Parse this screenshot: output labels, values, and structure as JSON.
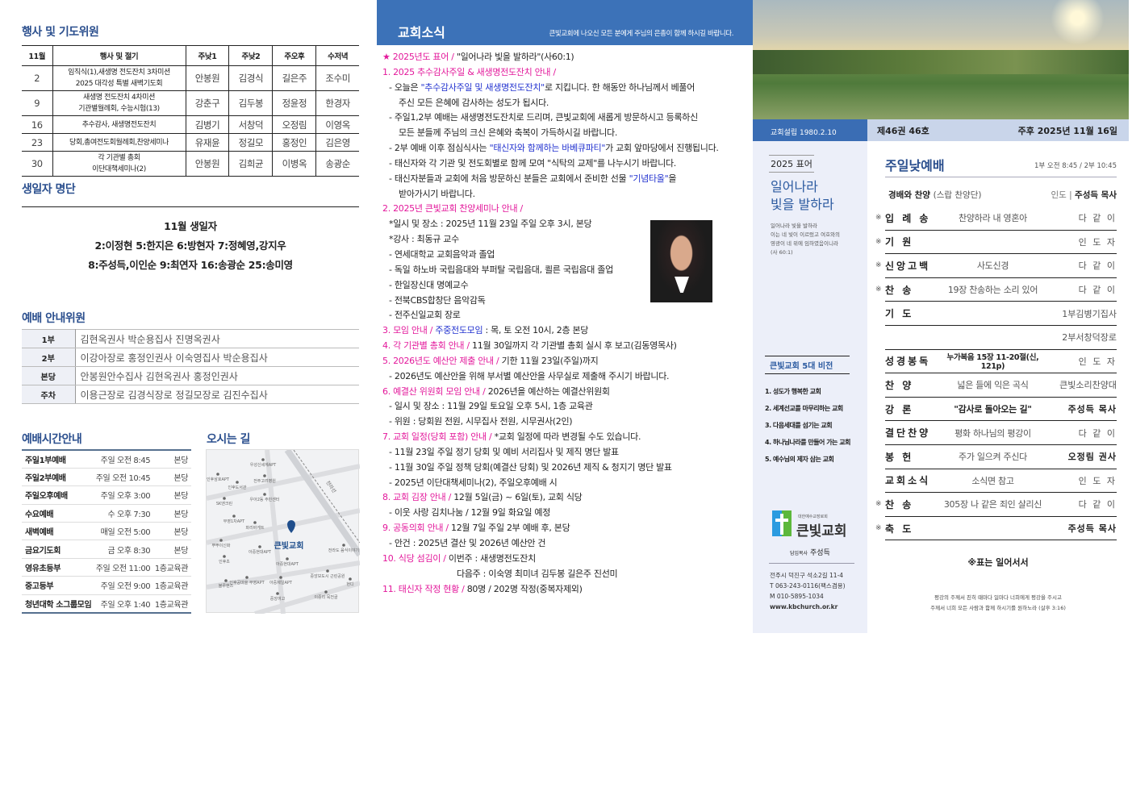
{
  "events": {
    "title": "행사 및 기도위원",
    "headers": [
      "11월",
      "행사 및 절기",
      "주낮1",
      "주낮2",
      "주오후",
      "수저녁"
    ],
    "rows": [
      {
        "d": "2",
        "e1": "임직식(1),새생명 전도잔치 3차미션",
        "e2": "2025 대각성 특별 새벽기도회",
        "a": "안봉원",
        "b": "김경식",
        "c": "길은주",
        "w": "조수미"
      },
      {
        "d": "9",
        "e1": "새생명 전도잔치 4차미션",
        "e2": "기관별월례회, 수능시험(13)",
        "a": "강춘구",
        "b": "김두봉",
        "c": "정윤정",
        "w": "한경자"
      },
      {
        "d": "16",
        "e1": "추수감사, 새생명전도잔치",
        "e2": "",
        "a": "김병기",
        "b": "서창덕",
        "c": "오정림",
        "w": "이영옥"
      },
      {
        "d": "23",
        "e1": "당회,총여전도회월례회,찬양세미나",
        "e2": "",
        "a": "유재윤",
        "b": "정길모",
        "c": "홍정인",
        "w": "김은영"
      },
      {
        "d": "30",
        "e1": "각 기관별 총회",
        "e2": "이단대책세미나(2)",
        "a": "안봉원",
        "b": "김희균",
        "c": "이병옥",
        "w": "송광순"
      }
    ]
  },
  "birthdays": {
    "title": "생일자 명단",
    "heading": "11월 생일자",
    "line1": "2:이정현 5:한지은 6:방현자 7:정혜영,강지우",
    "line2": "8:주성득,이인순 9:최연자 16:송광순 25:송미영"
  },
  "ushers": {
    "title": "예배 안내위원",
    "rows": [
      {
        "k": "1부",
        "v": "김현옥권사 박순용집사 진명옥권사"
      },
      {
        "k": "2부",
        "v": "이강아장로 홍정인권사 이숙영집사 박순용집사"
      },
      {
        "k": "본당",
        "v": "안봉원안수집사 김현옥권사 홍정인권사"
      },
      {
        "k": "주차",
        "v": "이용근장로 김경식장로 정길모장로 김진수집사"
      }
    ]
  },
  "times": {
    "title": "예배시간안내",
    "rows": [
      {
        "n": "주일1부예배",
        "w": "주일 오전 8:45",
        "p": "본당"
      },
      {
        "n": "주일2부예배",
        "w": "주일 오전 10:45",
        "p": "본당"
      },
      {
        "n": "주일오후예배",
        "w": "주일 오후 3:00",
        "p": "본당"
      },
      {
        "n": "수요예배",
        "w": "수 오후 7:30",
        "p": "본당"
      },
      {
        "n": "새벽예배",
        "w": "매일 오전 5:00",
        "p": "본당"
      },
      {
        "n": "금요기도회",
        "w": "금 오후 8:30",
        "p": "본당"
      },
      {
        "n": "영유초등부",
        "w": "주일 오전 11:00",
        "p": "1층교육관"
      },
      {
        "n": "중고등부",
        "w": "주일 오전 9:00",
        "p": "1층교육관"
      },
      {
        "n": "청년대학 소그룹모임",
        "w": "주일 오후 1:40",
        "p": "1층교육관"
      }
    ]
  },
  "map": {
    "title": "오시는 길",
    "church": "큰빛교회",
    "road": "전라선",
    "labels": [
      "우성신세계APT",
      "인후삼호APT",
      "전주고려병원",
      "인후도서관",
      "SK엔크린",
      "우아2동 주민센터",
      "부영1차APT",
      "파리바게트",
      "뿌뿌이신화",
      "아중현대APT",
      "인후초",
      "전라도 음식이야기",
      "아중현대APT",
      "중앙보도시 근린공원",
      "인후공마을 부영APT",
      "아중제일APT",
      "블루핸즈",
      "중앙여고",
      "이중리 묵전골",
      "현디"
    ]
  },
  "news": {
    "title": "교회소식",
    "subtitle": "큰빛교회에 나오신 모든 분에게 주님의 은총이 함께 하시길 바랍니다.",
    "lines": [
      {
        "i": 0,
        "s": [
          {
            "c": "m",
            "t": "★ 2025년도 표어 / "
          },
          {
            "c": "k",
            "t": "\"일어나라 빛을 발하라\"(사60:1)"
          }
        ]
      },
      {
        "i": 0,
        "s": [
          {
            "c": "m",
            "t": "1. 2025 추수감사주일 & 새생명전도잔치 안내 /"
          }
        ]
      },
      {
        "i": 1,
        "s": [
          {
            "c": "k",
            "t": "- 오늘은 "
          },
          {
            "c": "b",
            "t": "\"추수감사주일 및 새생명전도잔치\""
          },
          {
            "c": "k",
            "t": "로 지킵니다. 한 해동안 하나님께서 베풀어"
          }
        ]
      },
      {
        "i": 2,
        "s": [
          {
            "c": "k",
            "t": "주신 모든 은혜에 감사하는 성도가 됩시다."
          }
        ]
      },
      {
        "i": 1,
        "s": [
          {
            "c": "k",
            "t": "- 주일1,2부 예배는 새생명전도잔치로 드리며, 큰빛교회에 새롭게 방문하시고 등록하신"
          }
        ]
      },
      {
        "i": 2,
        "s": [
          {
            "c": "k",
            "t": "모든 분들께 주님의 크신 은혜와 축복이 가득하시길 바랍니다."
          }
        ]
      },
      {
        "i": 1,
        "s": [
          {
            "c": "k",
            "t": "- 2부 예배 이후 점심식사는 "
          },
          {
            "c": "b",
            "t": "\"태신자와 함께하는 바베큐파티\""
          },
          {
            "c": "k",
            "t": "가 교회 앞마당에서 진행됩니다."
          }
        ]
      },
      {
        "i": 1,
        "s": [
          {
            "c": "k",
            "t": "- 태신자와 각 기관 및 전도회별로 함께 모여 \"식탁의 교제\"를 나누시기 바랍니다."
          }
        ]
      },
      {
        "i": 1,
        "s": [
          {
            "c": "k",
            "t": "- 태신자분들과 교회에 처음 방문하신 분들은 교회에서 준비한 선물 "
          },
          {
            "c": "b",
            "t": "\"기념타올\""
          },
          {
            "c": "k",
            "t": "을"
          }
        ]
      },
      {
        "i": 2,
        "s": [
          {
            "c": "k",
            "t": "받아가시기 바랍니다."
          }
        ]
      },
      {
        "i": 0,
        "s": [
          {
            "c": "m",
            "t": "2. 2025년 큰빛교회 찬양세미나 안내 /"
          }
        ]
      },
      {
        "i": 1,
        "s": [
          {
            "c": "k",
            "t": "*일시 및 장소 : 2025년 11월 23일 주일 오후 3시, 본당"
          }
        ]
      },
      {
        "i": 1,
        "s": [
          {
            "c": "k",
            "t": "*강사 : 최동규 교수"
          }
        ]
      },
      {
        "i": 1,
        "s": [
          {
            "c": "k",
            "t": "- 연세대학교 교회음악과 졸업"
          }
        ]
      },
      {
        "i": 1,
        "s": [
          {
            "c": "k",
            "t": "- 독일 하노바 국립음대와 부퍼탈 국립음대, 쾰른 국립음대 졸업"
          }
        ]
      },
      {
        "i": 1,
        "s": [
          {
            "c": "k",
            "t": "- 한일장신대 명예교수"
          }
        ]
      },
      {
        "i": 1,
        "s": [
          {
            "c": "k",
            "t": "- 전북CBS합창단 음악감독"
          }
        ]
      },
      {
        "i": 1,
        "s": [
          {
            "c": "k",
            "t": "- 전주신일교회 장로"
          }
        ]
      },
      {
        "i": 0,
        "s": [
          {
            "c": "m",
            "t": "3. 모임 안내 / "
          },
          {
            "c": "b",
            "t": "주중전도모임"
          },
          {
            "c": "k",
            "t": " : 목, 토 오전 10시, 2층 본당"
          }
        ]
      },
      {
        "i": 0,
        "s": [
          {
            "c": "m",
            "t": "4. 각 기관별 총회 안내 / "
          },
          {
            "c": "k",
            "t": "11월 30일까지 각 기관별 총회 실시 후 보고(김동영목사)"
          }
        ]
      },
      {
        "i": 0,
        "s": [
          {
            "c": "m",
            "t": "5. 2026년도 예산안 제출 안내 / "
          },
          {
            "c": "k",
            "t": "기한 11월 23일(주일)까지"
          }
        ]
      },
      {
        "i": 1,
        "s": [
          {
            "c": "k",
            "t": "- 2026년도 예산안을 위해 부서별 예산안을 사무실로 제출해 주시기 바랍니다."
          }
        ]
      },
      {
        "i": 0,
        "s": [
          {
            "c": "m",
            "t": "6. 예결산 위원회 모임 안내 / "
          },
          {
            "c": "k",
            "t": "2026년을 예산하는 예결산위원회"
          }
        ]
      },
      {
        "i": 1,
        "s": [
          {
            "c": "k",
            "t": "- 일시 및 장소 : 11월 29일 토요일 오후 5시, 1층 교육관"
          }
        ]
      },
      {
        "i": 1,
        "s": [
          {
            "c": "k",
            "t": "- 위원 : 당회원 전원, 시무집사 전원, 시무권사(2인)"
          }
        ]
      },
      {
        "i": 0,
        "s": [
          {
            "c": "m",
            "t": "7. 교회 일정(당회 포함) 안내 / "
          },
          {
            "c": "k",
            "t": "*교회 일정에 따라 변경될 수도 있습니다."
          }
        ]
      },
      {
        "i": 1,
        "s": [
          {
            "c": "k",
            "t": "- 11월 23일 주일 정기 당회 및 예비 서리집사 및 제직 명단 발표"
          }
        ]
      },
      {
        "i": 1,
        "s": [
          {
            "c": "k",
            "t": "- 11월 30일 주일 정책 당회(예결산 당회) 및 2026년 제직 & 청지기 명단 발표"
          }
        ]
      },
      {
        "i": 1,
        "s": [
          {
            "c": "k",
            "t": "- 2025년 이단대책세미나(2), 주일오후예배 시"
          }
        ]
      },
      {
        "i": 0,
        "s": [
          {
            "c": "m",
            "t": "8. 교회 김장 안내 / "
          },
          {
            "c": "k",
            "t": "12월 5일(금) ~ 6일(토), 교회 식당"
          }
        ]
      },
      {
        "i": 1,
        "s": [
          {
            "c": "k",
            "t": "- 이웃 사랑 김치나눔 / 12월 9일 화요일 예정"
          }
        ]
      },
      {
        "i": 0,
        "s": [
          {
            "c": "m",
            "t": "9. 공동의회 안내 / "
          },
          {
            "c": "k",
            "t": "12월 7일 주일 2부 예배 후, 본당"
          }
        ]
      },
      {
        "i": 1,
        "s": [
          {
            "c": "k",
            "t": "- 안건 : 2025년 결산 및 2026년 예산안 건"
          }
        ]
      },
      {
        "i": 0,
        "s": [
          {
            "c": "m",
            "t": "10. 식당 섬김이 / "
          },
          {
            "c": "k",
            "t": "이번주 : 새생명전도잔치"
          }
        ]
      },
      {
        "i": 3,
        "s": [
          {
            "c": "k",
            "t": "다음주 : 이숙영 최미녀 김두봉 길은주 진선미"
          }
        ]
      },
      {
        "i": 0,
        "s": [
          {
            "c": "m",
            "t": "11. 태신자 작정 현황 / "
          },
          {
            "c": "k",
            "t": "80명 / 202명 작정(중복자제외)"
          }
        ]
      }
    ]
  },
  "cover": {
    "founded": "교회설립 1980.2.10",
    "volume": "제46권 46호",
    "date": "주후 2025년 11월 16일",
    "motto_label": "2025 표어",
    "motto_l1": "일어나라",
    "motto_l2": "빛을 발하라",
    "verse": [
      "일어나라 빛을 발하라",
      "이는 네 빛이 이르렀고 여호와의",
      "영광이 네 위에 임하였음이니라",
      "(사 60:1)"
    ],
    "vision_title": "큰빛교회 5대 비전",
    "vision": [
      "1. 성도가 행복한 교회",
      "2. 세계선교를 마무리하는 교회",
      "3. 다음세대를 섬기는 교회",
      "4. 하나님나라를 만들어 가는 교회",
      "5. 예수님의 제자 삼는 교회"
    ],
    "denomination": "대한예수교장로회",
    "church": "큰빛교회",
    "pastor_label": "담임목사",
    "pastor": "주성득",
    "address": "전주시 덕진구 석소2길 11-4",
    "tel": "T  063-243-0116(팩스겸용)",
    "mobile": "M 010-5895-1034",
    "web": "www.kbchurch.or.kr"
  },
  "worship": {
    "title": "주일낮예배",
    "time": "1부 오전 8:45 / 2부 10:45",
    "praise": "경배와 찬양",
    "praise_team": "(스랍 찬양단)",
    "lead_label": "인도 |",
    "lead": "주성득 목사",
    "rows": [
      {
        "s": "※",
        "n": "입 례 송",
        "c": "찬양하라 내 영혼아",
        "l": "다 같 이"
      },
      {
        "s": "※",
        "n": "기    원",
        "c": "",
        "l": "인 도 자"
      },
      {
        "s": "※",
        "n": "신앙고백",
        "c": "사도신경",
        "l": "다 같 이"
      },
      {
        "s": "※",
        "n": "찬    송",
        "c": "19장 찬송하는 소리 있어",
        "l": "다 같 이"
      },
      {
        "s": "",
        "n": "기    도",
        "c": "",
        "l": "1부김병기집사"
      },
      {
        "s": "",
        "n": "",
        "c": "",
        "l": "2부서창덕장로"
      },
      {
        "s": "",
        "n": "성경봉독",
        "c": "누가복음 15장 11-20절(신, 121p)",
        "l": "인 도 자"
      },
      {
        "s": "",
        "n": "찬    양",
        "c": "넓은 들에 익은 곡식",
        "l": "큰빛소리찬양대"
      },
      {
        "s": "",
        "n": "강    론",
        "c": "\"감사로 돌아오는 길\"",
        "l": "주성득 목사"
      },
      {
        "s": "",
        "n": "결단찬양",
        "c": "평화 하나님의 평강이",
        "l": "다 같 이"
      },
      {
        "s": "",
        "n": "봉    헌",
        "c": "주가 일으켜 주신다",
        "l": "오정림 권사"
      },
      {
        "s": "",
        "n": "교회소식",
        "c": "소식면 참고",
        "l": "인 도 자"
      },
      {
        "s": "※",
        "n": "찬    송",
        "c": "305장 나 같은 죄인 살리신",
        "l": "다 같 이"
      },
      {
        "s": "※",
        "n": "축    도",
        "c": "",
        "l": "주성득 목사"
      }
    ],
    "note": "※표는 일어서서",
    "bless1": "평강의 주께서 친히 때마다 일마다 너희에게 평강을 주시고",
    "bless2": "주께서 너희 모든 사람과 함께 하시기를 원하노라 (살후 3:16)"
  },
  "colors": {
    "accent": "#3c72b8",
    "magenta": "#e3189b",
    "blue": "#2232cf",
    "sidebar": "#eceff9"
  }
}
